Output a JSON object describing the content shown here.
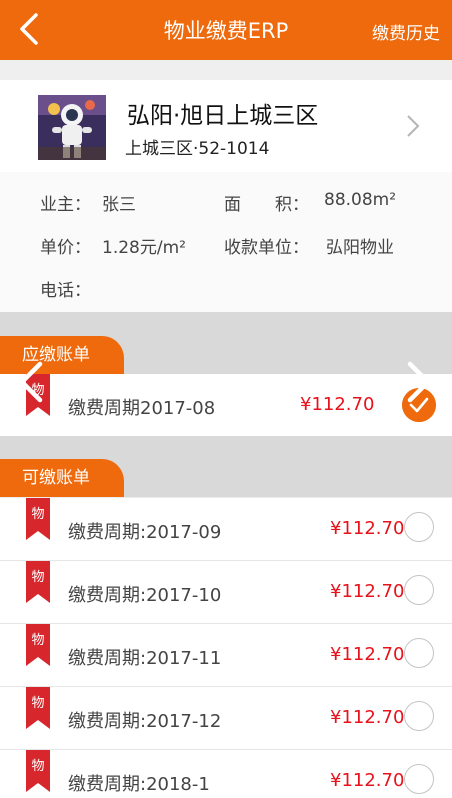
{
  "topbar": {
    "title": "物业缴费ERP",
    "history_label": "缴费历史",
    "accent_color": "#ee6a0d",
    "back_icon": "chevron-left-icon"
  },
  "property": {
    "name": "弘阳·旭日上城三区",
    "unit": "上城三区·52-1014",
    "avatar": "astronaut-avatar",
    "detail_icon": "chevron-right-icon"
  },
  "info": {
    "owner_label": "业主：",
    "owner_value": "张三",
    "area_label": "面　　积：",
    "area_value": "88.08m²",
    "price_label": "单价：",
    "price_value": "1.28元/m²",
    "payee_label": "收款单位：",
    "payee_value": "弘阳物业",
    "phone_label": "电话："
  },
  "due_section": {
    "title": "应缴账单",
    "bills": [
      {
        "tag": "物",
        "label": "缴费周期2017-08",
        "amount": "¥112.70",
        "selected": true
      }
    ]
  },
  "payable_section": {
    "title": "可缴账单",
    "bills": [
      {
        "tag": "物",
        "label": "缴费周期:2017-09",
        "amount": "¥112.70",
        "selected": false
      },
      {
        "tag": "物",
        "label": "缴费周期:2017-10",
        "amount": "¥112.70",
        "selected": false
      },
      {
        "tag": "物",
        "label": "缴费周期:2017-11",
        "amount": "¥112.70",
        "selected": false
      },
      {
        "tag": "物",
        "label": "缴费周期:2017-12",
        "amount": "¥112.70",
        "selected": false
      },
      {
        "tag": "物",
        "label": "缴费周期:2018-1",
        "amount": "¥112.70",
        "selected": false
      }
    ]
  },
  "colors": {
    "amount": "#e8121b",
    "tag": "#d7272c"
  }
}
